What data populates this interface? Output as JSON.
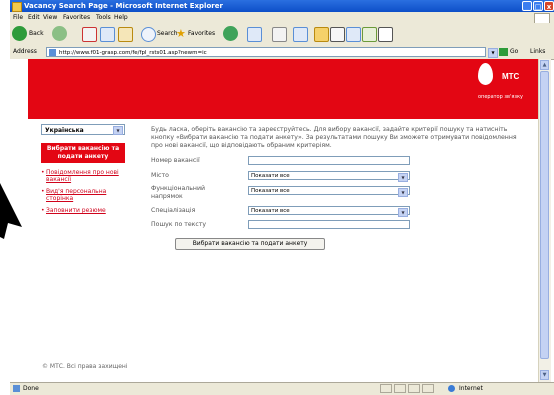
{
  "window": {
    "title": "Vacancy Search Page - Microsoft Internet Explorer",
    "btn_min": "_",
    "btn_max": "□",
    "btn_close": "x"
  },
  "menu": [
    "File",
    "Edit",
    "View",
    "Favorites",
    "Tools",
    "Help"
  ],
  "toolbar": {
    "back": "Back",
    "search": "Search",
    "favorites": "Favorites"
  },
  "address": {
    "label": "Address",
    "url": "http://www.f01-grasp.com/fe/fpl_rsts01.asp?newm=ic",
    "go": "Go",
    "links": "Links"
  },
  "brand": {
    "name": "МТС",
    "slogan": "оператор зв'язку",
    "color": "#e30613"
  },
  "sidebar": {
    "language": "Українська",
    "apply_button": "Вибрати вакансію та подати анкету",
    "links": [
      "Повідомлення про нові вакансії",
      "Вид'я персональна сторінка",
      "Заповнити резюме"
    ],
    "copyright": "© МТС. Всі права захищені"
  },
  "main": {
    "intro": "Будь ласка, оберіть вакансію та зареєструйтесь. Для вибору вакансії, задайте критерії пошуку та натисніть кнопку «Вибрати вакансію та подати анкету». За результатами пошуку Ви зможете отримувати повідомлення про нові вакансії, що відповідають обраним критеріям.",
    "fields": [
      {
        "label": "Номер вакансії",
        "value": ""
      },
      {
        "label": "Місто",
        "value": "Показати все"
      },
      {
        "label": "Функціональний напрямок",
        "value": "Показати все"
      },
      {
        "label": "Спеціалізація",
        "value": "Показати все"
      },
      {
        "label": "Пошук по тексту",
        "value": ""
      }
    ],
    "submit": "Вибрати вакансію та подати анкету"
  },
  "status": {
    "left": "Done",
    "zone": "Internet"
  }
}
